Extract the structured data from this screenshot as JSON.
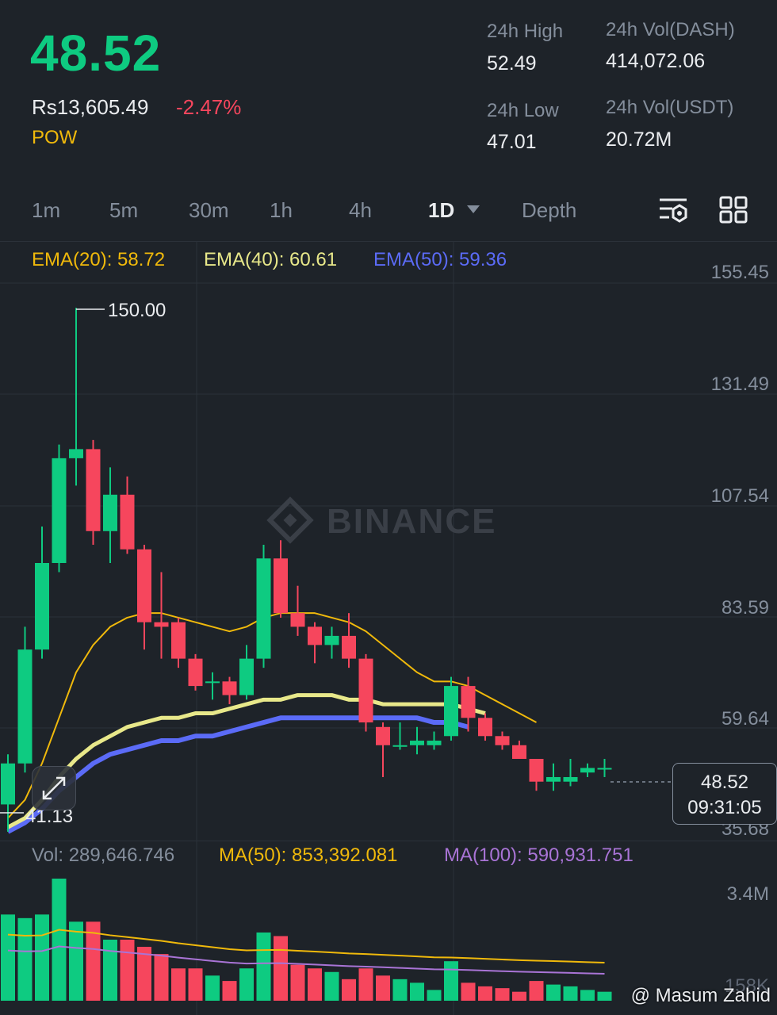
{
  "header": {
    "last_price": "48.52",
    "fiat_price": "Rs13,605.49",
    "change_pct": "-2.47%",
    "tag": "POW",
    "high_label": "24h High",
    "high_value": "52.49",
    "low_label": "24h Low",
    "low_value": "47.01",
    "vol_base_label": "24h Vol(DASH)",
    "vol_base_value": "414,072.06",
    "vol_quote_label": "24h Vol(USDT)",
    "vol_quote_value": "20.72M"
  },
  "intervals": [
    "1m",
    "5m",
    "30m",
    "1h",
    "4h",
    "1D",
    "Depth"
  ],
  "active_interval": "1D",
  "indicators": {
    "ema20": "EMA(20): 58.72",
    "ema40": "EMA(40): 60.61",
    "ema50": "EMA(50): 59.36",
    "ema20_color": "#f0b90b",
    "ema40_color": "#e8e88a",
    "ema50_color": "#5b6bf7"
  },
  "price_axis": [
    "155.45",
    "131.49",
    "107.54",
    "83.59",
    "59.64",
    "35.68"
  ],
  "watermark": "BINANCE",
  "max_marker": "150.00",
  "min_marker": "41.13",
  "current_price_tag": "48.52",
  "countdown": "09:31:05",
  "volume_panel": {
    "vol": "Vol: 289,646.746",
    "ma50": "MA(50): 853,392.081",
    "ma100": "MA(100): 590,931.751",
    "axis_top": "3.4M",
    "axis_bottom": "158K"
  },
  "credit": "@ Masum Zahid",
  "colors": {
    "up": "#0ecb81",
    "down": "#f6465d",
    "bg": "#1e2329"
  },
  "chart_data": {
    "type": "candlestick",
    "ylim": [
      35.68,
      155.45
    ],
    "candles": [
      {
        "o": 41,
        "h": 52,
        "l": 35,
        "c": 50
      },
      {
        "o": 50,
        "h": 80,
        "l": 48,
        "c": 75
      },
      {
        "o": 75,
        "h": 102,
        "l": 73,
        "c": 94
      },
      {
        "o": 94,
        "h": 120,
        "l": 92,
        "c": 117
      },
      {
        "o": 117,
        "h": 150,
        "l": 111,
        "c": 119
      },
      {
        "o": 119,
        "h": 121,
        "l": 98,
        "c": 101
      },
      {
        "o": 101,
        "h": 115,
        "l": 94,
        "c": 109
      },
      {
        "o": 109,
        "h": 113,
        "l": 96,
        "c": 97
      },
      {
        "o": 97,
        "h": 98,
        "l": 75,
        "c": 81
      },
      {
        "o": 81,
        "h": 92,
        "l": 73,
        "c": 80
      },
      {
        "o": 81,
        "h": 82,
        "l": 71,
        "c": 73
      },
      {
        "o": 73,
        "h": 74,
        "l": 66,
        "c": 67
      },
      {
        "o": 68,
        "h": 70,
        "l": 64,
        "c": 68
      },
      {
        "o": 68,
        "h": 69,
        "l": 63,
        "c": 65
      },
      {
        "o": 65,
        "h": 76,
        "l": 64,
        "c": 73
      },
      {
        "o": 73,
        "h": 98,
        "l": 71,
        "c": 95
      },
      {
        "o": 95,
        "h": 99,
        "l": 82,
        "c": 83
      },
      {
        "o": 83,
        "h": 89,
        "l": 78,
        "c": 80
      },
      {
        "o": 80,
        "h": 81,
        "l": 72,
        "c": 76
      },
      {
        "o": 76,
        "h": 80,
        "l": 73,
        "c": 78
      },
      {
        "o": 78,
        "h": 83,
        "l": 71,
        "c": 73
      },
      {
        "o": 73,
        "h": 74,
        "l": 57,
        "c": 59
      },
      {
        "o": 58,
        "h": 59,
        "l": 47,
        "c": 54
      },
      {
        "o": 54,
        "h": 59,
        "l": 53,
        "c": 54
      },
      {
        "o": 54,
        "h": 58,
        "l": 52,
        "c": 55
      },
      {
        "o": 54,
        "h": 57,
        "l": 53,
        "c": 55
      },
      {
        "o": 56,
        "h": 69,
        "l": 55,
        "c": 67
      },
      {
        "o": 67,
        "h": 69,
        "l": 57,
        "c": 60
      },
      {
        "o": 60,
        "h": 61,
        "l": 55,
        "c": 56
      },
      {
        "o": 56,
        "h": 57,
        "l": 53,
        "c": 54
      },
      {
        "o": 54,
        "h": 55,
        "l": 51,
        "c": 51
      },
      {
        "o": 51,
        "h": 51,
        "l": 44,
        "c": 46
      },
      {
        "o": 46,
        "h": 50,
        "l": 44,
        "c": 47
      },
      {
        "o": 46,
        "h": 51,
        "l": 45,
        "c": 47
      },
      {
        "o": 48,
        "h": 50,
        "l": 47,
        "c": 49
      },
      {
        "o": 49,
        "h": 51,
        "l": 47,
        "c": 49
      }
    ],
    "ema20": [
      38,
      42,
      50,
      60,
      70,
      76,
      80,
      82,
      83,
      83,
      82,
      81,
      80,
      79,
      80,
      82,
      83,
      83,
      83,
      82,
      81,
      79,
      76,
      73,
      70,
      68,
      68,
      67,
      65,
      63,
      61,
      59
    ],
    "ema40": [
      36,
      38,
      42,
      47,
      51,
      54,
      56,
      58,
      59,
      60,
      60,
      61,
      61,
      62,
      63,
      64,
      64,
      65,
      65,
      65,
      64,
      64,
      63,
      63,
      63,
      63,
      63,
      62,
      61
    ],
    "ema50": [
      35,
      37,
      40,
      44,
      47,
      50,
      52,
      53,
      54,
      55,
      55,
      56,
      56,
      57,
      58,
      59,
      60,
      60,
      60,
      60,
      60,
      60,
      60,
      60,
      60,
      59,
      59,
      58
    ],
    "volume": [
      2.4,
      2.3,
      2.4,
      3.4,
      2.2,
      2.2,
      1.7,
      1.7,
      1.5,
      1.3,
      0.9,
      0.9,
      0.7,
      0.55,
      0.9,
      1.9,
      1.8,
      1.0,
      0.9,
      0.8,
      0.6,
      0.9,
      0.7,
      0.6,
      0.5,
      0.3,
      1.1,
      0.5,
      0.4,
      0.35,
      0.25,
      0.55,
      0.45,
      0.4,
      0.3,
      0.25
    ]
  }
}
